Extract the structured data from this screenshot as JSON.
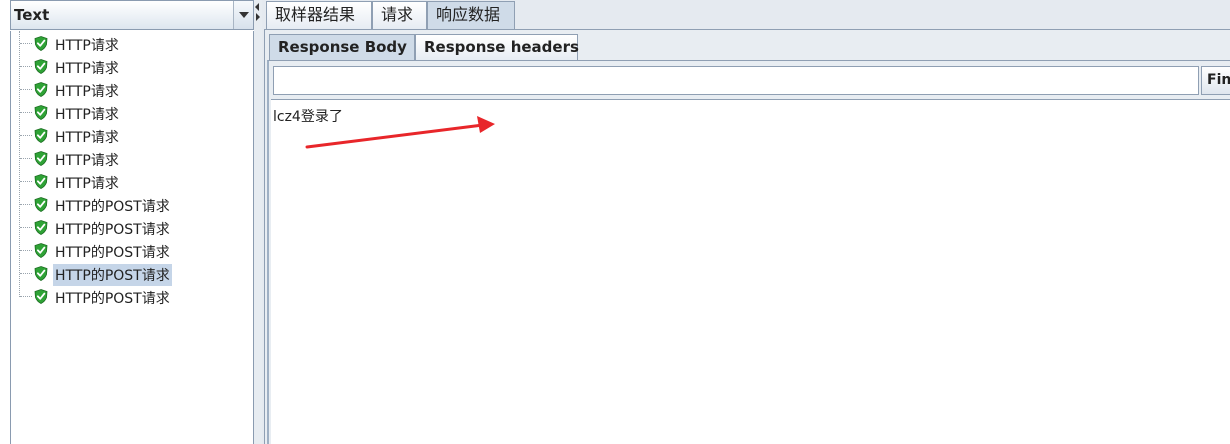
{
  "left_panel": {
    "combo_value": "Text",
    "tree_items": [
      {
        "label": "HTTP请求",
        "status": "success"
      },
      {
        "label": "HTTP请求",
        "status": "success"
      },
      {
        "label": "HTTP请求",
        "status": "success"
      },
      {
        "label": "HTTP请求",
        "status": "success"
      },
      {
        "label": "HTTP请求",
        "status": "success"
      },
      {
        "label": "HTTP请求",
        "status": "success"
      },
      {
        "label": "HTTP请求",
        "status": "success"
      },
      {
        "label": "HTTP的POST请求",
        "status": "success"
      },
      {
        "label": "HTTP的POST请求",
        "status": "success"
      },
      {
        "label": "HTTP的POST请求",
        "status": "success"
      },
      {
        "label": "HTTP的POST请求",
        "status": "success",
        "selected": true
      },
      {
        "label": "HTTP的POST请求",
        "status": "success"
      }
    ],
    "icon": "green-shield-check-icon"
  },
  "top_tabs": [
    {
      "label": "取样器结果",
      "active": false
    },
    {
      "label": "请求",
      "active": false
    },
    {
      "label": "响应数据",
      "active": true
    }
  ],
  "inner_tabs": [
    {
      "label": "Response Body",
      "active": true
    },
    {
      "label": "Response headers",
      "active": false
    }
  ],
  "search": {
    "value": "",
    "placeholder": ""
  },
  "find_button_label": "Find",
  "response_body": "lcz4登录了",
  "colors": {
    "selection": "#c5d5e8",
    "shield_green": "#2fa336",
    "annotation_arrow": "#e8262a",
    "panel_bg": "#e5eaf0"
  }
}
